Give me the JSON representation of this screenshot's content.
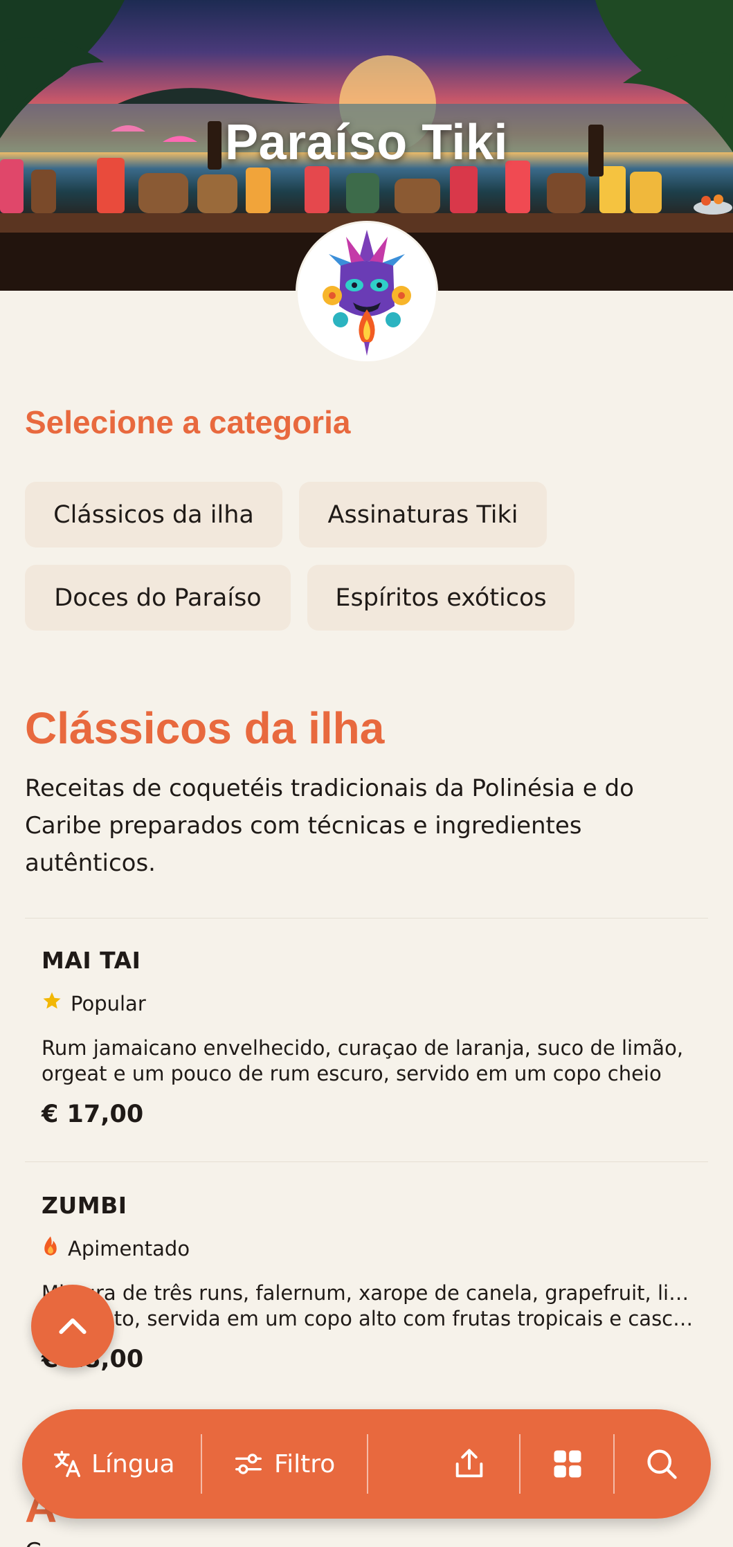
{
  "restaurant": {
    "name": "Paraíso Tiki"
  },
  "category_selector": {
    "heading": "Selecione a categoria",
    "categories": [
      "Clássicos da ilha",
      "Assinaturas Tiki",
      "Doces do Paraíso",
      "Espíritos exóticos"
    ]
  },
  "current_category": {
    "title": "Clássicos da ilha",
    "description": "Receitas de coquetéis tradicionais da Polinésia e do Caribe preparados com técnicas e ingredientes autênticos.",
    "items": [
      {
        "name": "MAI TAI",
        "tag": "Popular",
        "tag_icon": "star-icon",
        "description": "Rum jamaicano envelhecido, curaçao de laranja, suco de limão, orgeat e um pouco de rum escuro, servido em um copo cheio d...",
        "price": "€ 17,00"
      },
      {
        "name": "ZUMBI",
        "tag": "Apimentado",
        "tag_icon": "flame-icon",
        "description_line1": "Mistura de três runs, falernum, xarope de canela, grapefruit, limão",
        "description_line2": "e absinto, servida em um copo alto com frutas tropicais e casca...",
        "price": "€ 18,00"
      }
    ]
  },
  "next_category_peek": {
    "title": "A",
    "description": "C"
  },
  "bottom_nav": {
    "language_label": "Língua",
    "filter_label": "Filtro"
  },
  "colors": {
    "accent": "#e8693e",
    "background": "#f6f2ea",
    "chip": "#f2e8dc",
    "star": "#f2b705"
  }
}
